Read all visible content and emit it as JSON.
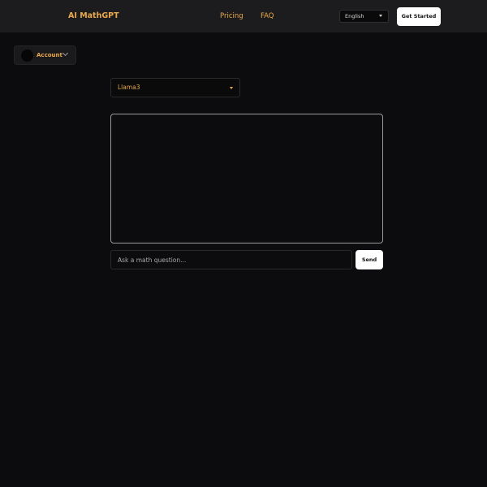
{
  "header": {
    "brand": "AI MathGPT",
    "nav": {
      "pricing": "Pricing",
      "faq": "FAQ"
    },
    "language": {
      "selected": "English"
    },
    "cta_label": "Get Started"
  },
  "account": {
    "label": "Account"
  },
  "model_select": {
    "selected": "Llama3"
  },
  "chat": {
    "input_placeholder": "Ask a math question...",
    "input_value": "",
    "send_label": "Send"
  },
  "colors": {
    "accent": "#e9a94a",
    "background": "#0c0c0e",
    "header_background": "#1c1c1e"
  }
}
